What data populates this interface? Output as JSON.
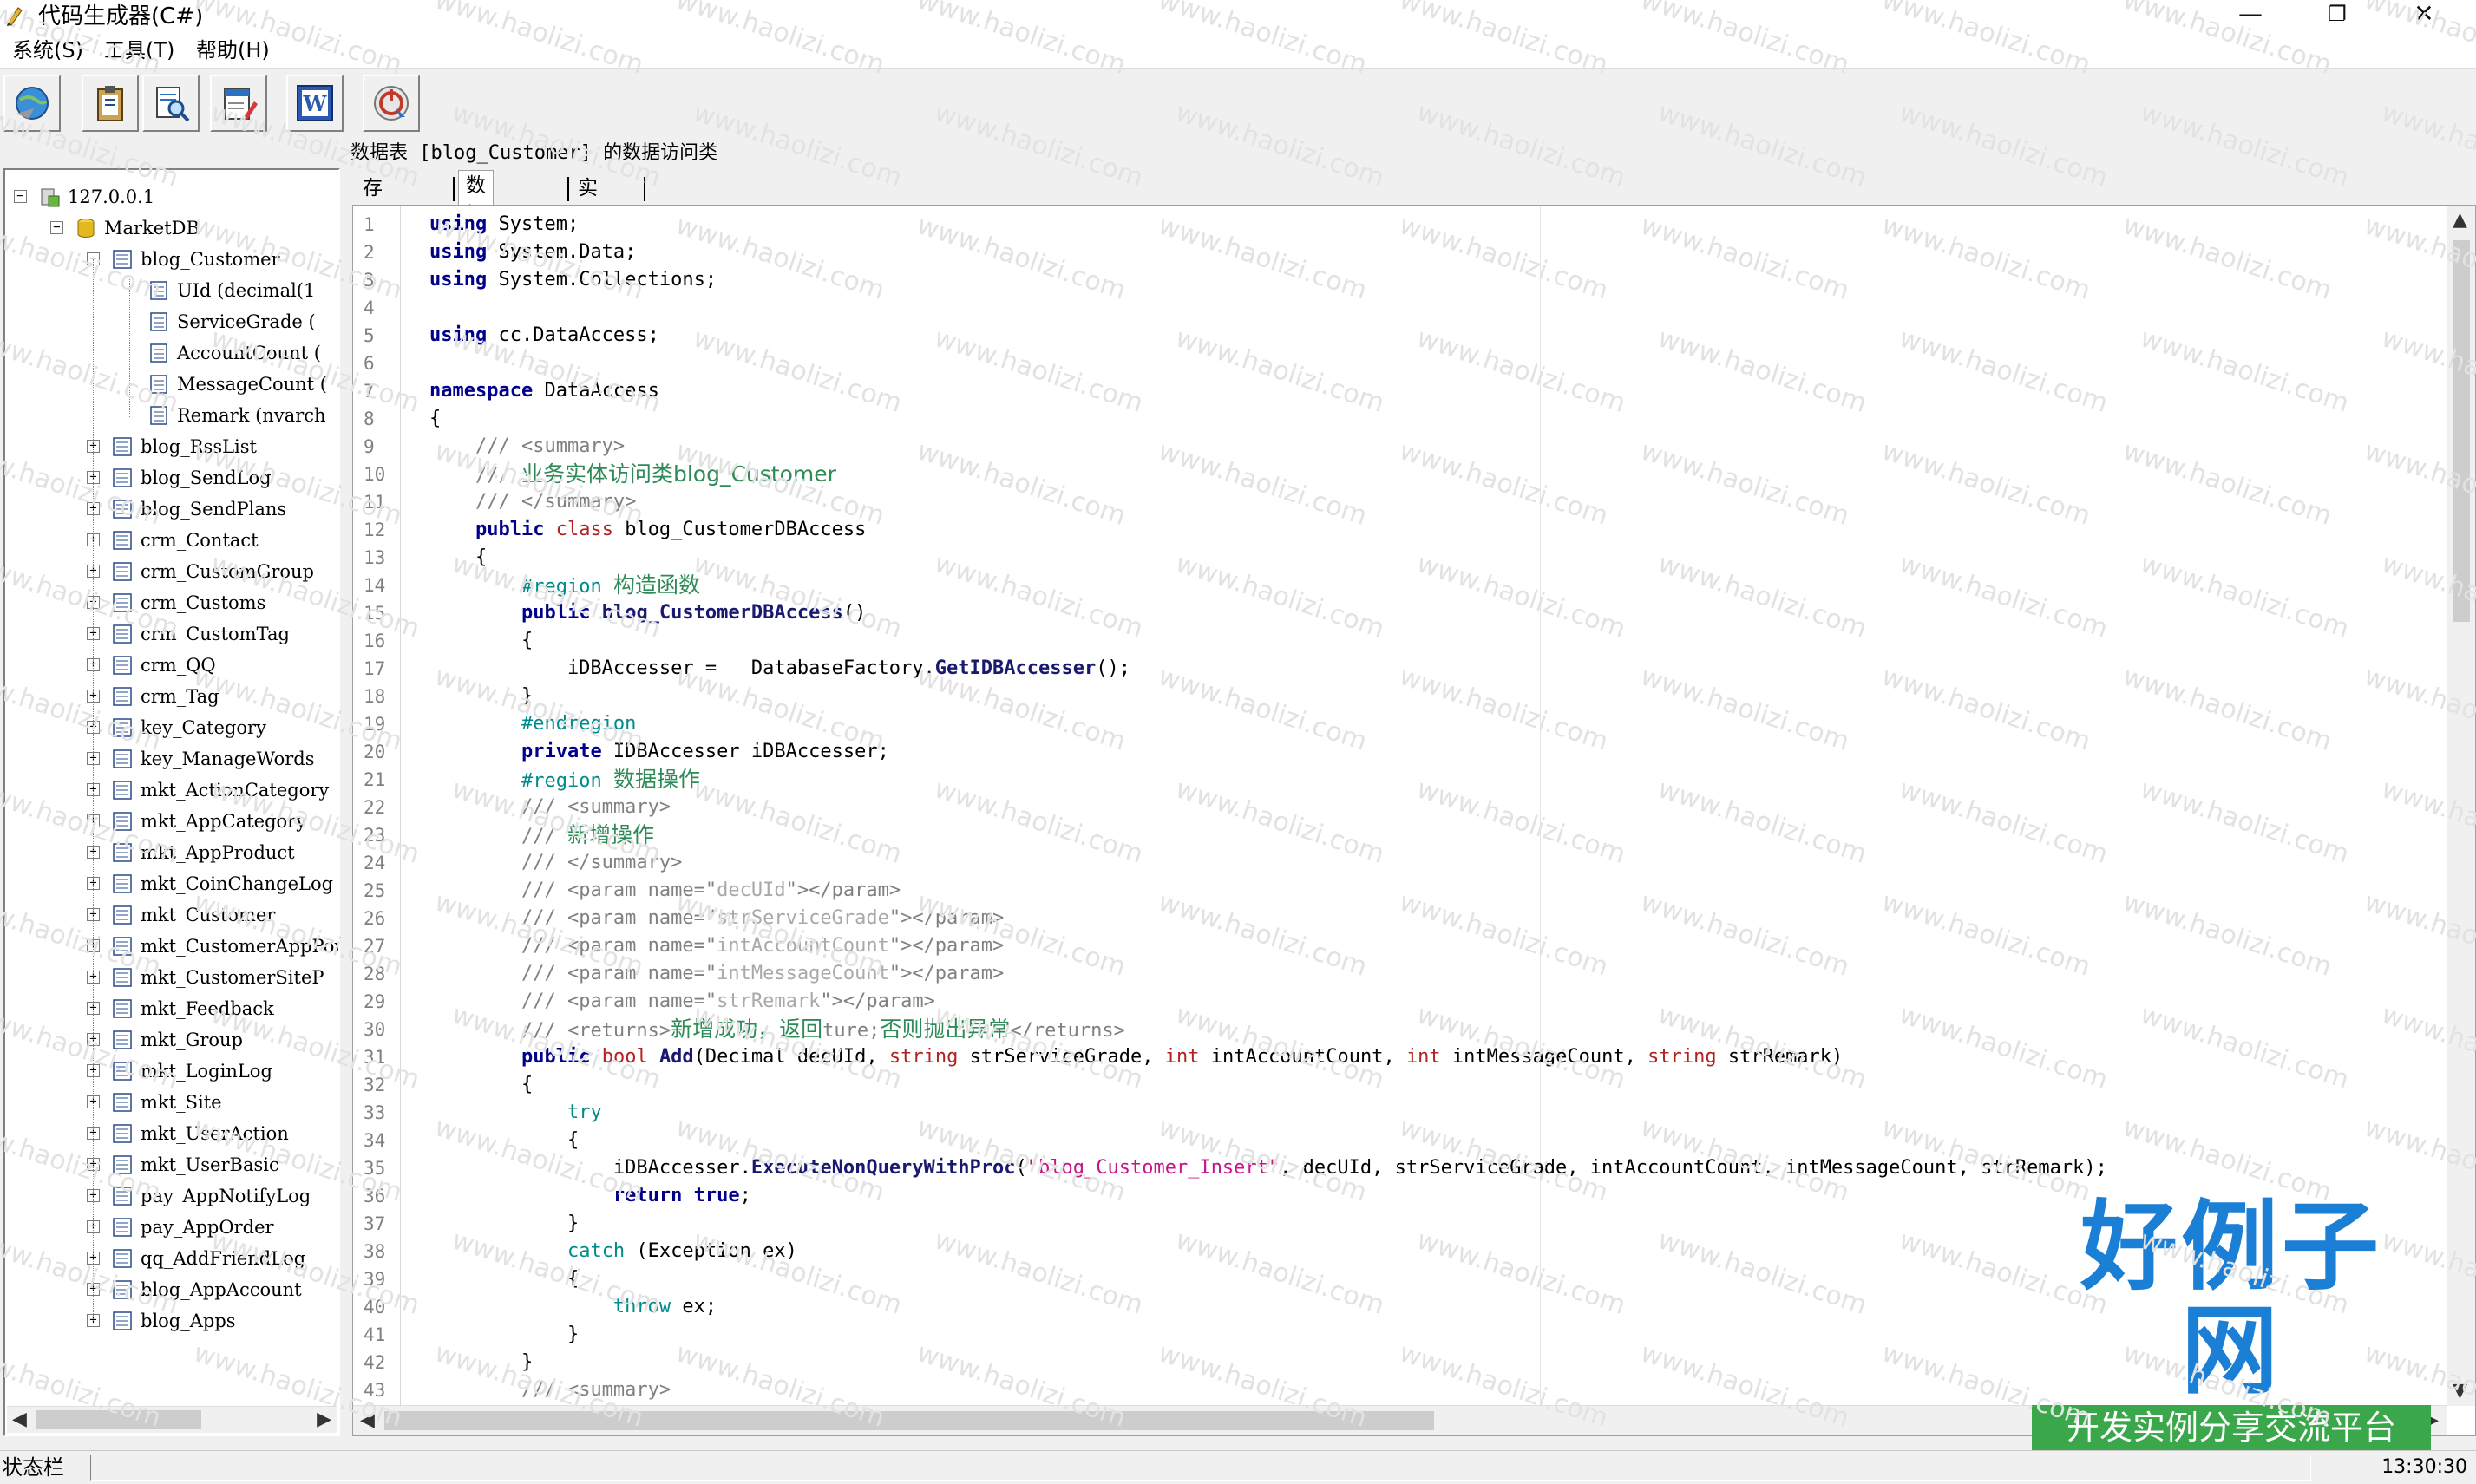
{
  "window": {
    "title": "代码生成器(C#)",
    "minimize": "—",
    "restore": "❐",
    "close": "✕"
  },
  "menu": [
    "系统(S)",
    "工具(T)",
    "帮助(H)"
  ],
  "toolbar": {
    "buttons": [
      {
        "name": "connect-button",
        "icon": "globe-connect-icon"
      },
      {
        "name": "generate-button",
        "icon": "clipboard-icon"
      },
      {
        "name": "query-button",
        "icon": "document-search-icon"
      },
      {
        "name": "settings-button",
        "icon": "document-edit-icon"
      },
      {
        "name": "word-button",
        "icon": "word-document-icon"
      },
      {
        "name": "exit-button",
        "icon": "power-arrow-icon"
      }
    ]
  },
  "tree": {
    "server": "127.0.0.1",
    "database": "MarketDB",
    "expanded_table": "blog_Customer",
    "columns": [
      "UId (decimal(1",
      "ServiceGrade (",
      "AccountCount (",
      "MessageCount (",
      "Remark (nvarch"
    ],
    "tables": [
      "blog_RssList",
      "blog_SendLog",
      "blog_SendPlans",
      "crm_Contact",
      "crm_CustomGroup",
      "crm_Customs",
      "crm_CustomTag",
      "crm_QQ",
      "crm_Tag",
      "key_Category",
      "key_ManageWords",
      "mkt_ActionCategory",
      "mkt_AppCategory",
      "mkt_AppProduct",
      "mkt_CoinChangeLog",
      "mkt_Customer",
      "mkt_CustomerAppPow",
      "mkt_CustomerSiteP",
      "mkt_Feedback",
      "mkt_Group",
      "mkt_LoginLog",
      "mkt_Site",
      "mkt_UserAction",
      "mkt_UserBasic",
      "pay_AppNotifyLog",
      "pay_AppOrder",
      "qq_AddFriendLog",
      "blog_AppAccount",
      "blog_Apps"
    ]
  },
  "caption": "数据表 [blog_Customer] 的数据访问类",
  "tabs": [
    "存储过程",
    "数据访问",
    "实体类"
  ],
  "active_tab": "数据访问",
  "code_lines": [
    [
      [
        "kw",
        "using"
      ],
      [
        "pl",
        " System;"
      ]
    ],
    [
      [
        "kw",
        "using"
      ],
      [
        "pl",
        " System.Data;"
      ]
    ],
    [
      [
        "kw",
        "using"
      ],
      [
        "pl",
        " System.Collections;"
      ]
    ],
    [],
    [
      [
        "kw",
        "using"
      ],
      [
        "pl",
        " cc.DataAccess;"
      ]
    ],
    [],
    [
      [
        "kw",
        "namespace"
      ],
      [
        "pl",
        " DataAccess"
      ]
    ],
    [
      [
        "pl",
        "{"
      ]
    ],
    [
      [
        "pl",
        "    "
      ],
      [
        "cm",
        "/// <summary>"
      ]
    ],
    [
      [
        "pl",
        "    "
      ],
      [
        "cm",
        "/// "
      ],
      [
        "cz",
        "业务实体访问类"
      ],
      [
        "cz",
        "blog_Customer"
      ]
    ],
    [
      [
        "pl",
        "    "
      ],
      [
        "cm",
        "/// </summary>"
      ]
    ],
    [
      [
        "pl",
        "    "
      ],
      [
        "kw",
        "public"
      ],
      [
        "pl",
        " "
      ],
      [
        "kr",
        "class"
      ],
      [
        "pl",
        " blog_CustomerDBAccess"
      ]
    ],
    [
      [
        "pl",
        "    {"
      ]
    ],
    [
      [
        "pl",
        "        "
      ],
      [
        "pr",
        "#region "
      ],
      [
        "cz",
        "构造函数"
      ]
    ],
    [
      [
        "pl",
        "        "
      ],
      [
        "kw",
        "public"
      ],
      [
        "pl",
        " "
      ],
      [
        "fn",
        "blog_CustomerDBAccess"
      ],
      [
        "pl",
        "()"
      ]
    ],
    [
      [
        "pl",
        "        {"
      ]
    ],
    [
      [
        "pl",
        "            iDBAccesser =   DatabaseFactory."
      ],
      [
        "fn",
        "GetIDBAccesser"
      ],
      [
        "pl",
        "();"
      ]
    ],
    [
      [
        "pl",
        "        }"
      ]
    ],
    [
      [
        "pl",
        "        "
      ],
      [
        "pr",
        "#endregion"
      ]
    ],
    [
      [
        "pl",
        "        "
      ],
      [
        "kw",
        "private"
      ],
      [
        "pl",
        " IDBAccesser iDBAccesser;"
      ]
    ],
    [
      [
        "pl",
        "        "
      ],
      [
        "pr",
        "#region "
      ],
      [
        "cz",
        "数据操作"
      ]
    ],
    [
      [
        "pl",
        "        "
      ],
      [
        "cm",
        "/// <summary>"
      ]
    ],
    [
      [
        "pl",
        "        "
      ],
      [
        "cm",
        "/// "
      ],
      [
        "cz",
        "新增操作"
      ]
    ],
    [
      [
        "pl",
        "        "
      ],
      [
        "cm",
        "/// </summary>"
      ]
    ],
    [
      [
        "pl",
        "        "
      ],
      [
        "cm",
        "/// <param name=\""
      ],
      [
        "stg",
        "decUId"
      ],
      [
        "cm",
        "\"></param>"
      ]
    ],
    [
      [
        "pl",
        "        "
      ],
      [
        "cm",
        "/// <param name=\""
      ],
      [
        "stg",
        "strServiceGrade"
      ],
      [
        "cm",
        "\"></param>"
      ]
    ],
    [
      [
        "pl",
        "        "
      ],
      [
        "cm",
        "/// <param name=\""
      ],
      [
        "stg",
        "intAccountCount"
      ],
      [
        "cm",
        "\"></param>"
      ]
    ],
    [
      [
        "pl",
        "        "
      ],
      [
        "cm",
        "/// <param name=\""
      ],
      [
        "stg",
        "intMessageCount"
      ],
      [
        "cm",
        "\"></param>"
      ]
    ],
    [
      [
        "pl",
        "        "
      ],
      [
        "cm",
        "/// <param name=\""
      ],
      [
        "stg",
        "strRemark"
      ],
      [
        "cm",
        "\"></param>"
      ]
    ],
    [
      [
        "pl",
        "        "
      ],
      [
        "cm",
        "/// <returns>"
      ],
      [
        "cz",
        "新增成功，返回"
      ],
      [
        "cm",
        "ture;"
      ],
      [
        "cz",
        "否则抛出异常"
      ],
      [
        "cm",
        "</returns>"
      ]
    ],
    [
      [
        "pl",
        "        "
      ],
      [
        "kw",
        "public"
      ],
      [
        "pl",
        " "
      ],
      [
        "kr",
        "bool"
      ],
      [
        "pl",
        " "
      ],
      [
        "fn",
        "Add"
      ],
      [
        "pl",
        "(Decimal decUId, "
      ],
      [
        "kr",
        "string"
      ],
      [
        "pl",
        " strServiceGrade, "
      ],
      [
        "kr",
        "int"
      ],
      [
        "pl",
        " intAccountCount, "
      ],
      [
        "kr",
        "int"
      ],
      [
        "pl",
        " intMessageCount, "
      ],
      [
        "kr",
        "string"
      ],
      [
        "pl",
        " strRemark)"
      ]
    ],
    [
      [
        "pl",
        "        {"
      ]
    ],
    [
      [
        "pl",
        "            "
      ],
      [
        "pr",
        "try"
      ]
    ],
    [
      [
        "pl",
        "            {"
      ]
    ],
    [
      [
        "pl",
        "                iDBAccesser."
      ],
      [
        "fn",
        "ExecuteNonQueryWithProc"
      ],
      [
        "pl",
        "("
      ],
      [
        "st",
        "\"blog_Customer_Insert\""
      ],
      [
        "pl",
        ", decUId, strServiceGrade, intAccountCount, intMessageCount, strRemark);"
      ]
    ],
    [
      [
        "pl",
        "                "
      ],
      [
        "kw",
        "return"
      ],
      [
        "pl",
        " "
      ],
      [
        "kw",
        "true"
      ],
      [
        "pl",
        ";"
      ]
    ],
    [
      [
        "pl",
        "            }"
      ]
    ],
    [
      [
        "pl",
        "            "
      ],
      [
        "pr",
        "catch"
      ],
      [
        "pl",
        " (Exception ex)"
      ]
    ],
    [
      [
        "pl",
        "            {"
      ]
    ],
    [
      [
        "pl",
        "                "
      ],
      [
        "pr",
        "throw"
      ],
      [
        "pl",
        " ex;"
      ]
    ],
    [
      [
        "pl",
        "            }"
      ]
    ],
    [
      [
        "pl",
        "        }"
      ]
    ],
    [
      [
        "pl",
        "        "
      ],
      [
        "cm",
        "/// <summary>"
      ]
    ]
  ],
  "status": {
    "label": "状态栏",
    "time": "13:30:30"
  },
  "watermark": "www.haolizi.com",
  "brand": {
    "name": "好例子网",
    "tagline": "开发实例分享交流平台"
  },
  "colors": {
    "keyword": "#00008b",
    "type_keyword": "#b22222",
    "comment": "#808080",
    "chinese_comment": "#2e8b57",
    "preprocessor": "#008b8b",
    "string": "#c71585",
    "brand_blue": "#1b7fd6",
    "brand_green": "#3aa74a"
  }
}
